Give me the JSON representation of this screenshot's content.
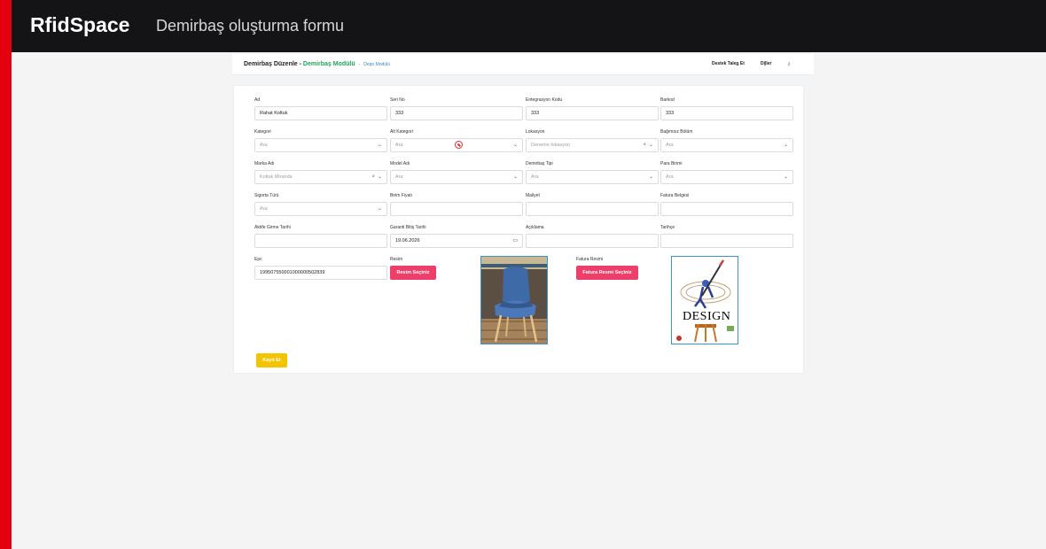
{
  "page": {
    "brand": "RfidSpace",
    "subtitle": "Demirbaş oluşturma formu"
  },
  "app": {
    "breadcrumb": {
      "title": "Demirbaş Düzenle -",
      "module": "Demirbaş Modülü",
      "separator": "-",
      "sub": "Depo Modülü"
    },
    "header_links": {
      "support": "Destek Talep Et",
      "languages": "Diller"
    }
  },
  "form": {
    "ad": {
      "label": "Ad",
      "value": "Rahat Koltuk"
    },
    "seri_no": {
      "label": "Seri No",
      "value": "333"
    },
    "entegrasyon_kodu": {
      "label": "Entegrasyon Kodu",
      "value": "333"
    },
    "barkod": {
      "label": "Barkod",
      "value": "333"
    },
    "kategori": {
      "label": "Kategori",
      "placeholder": "Ara"
    },
    "alt_kategori": {
      "label": "Alt Kategori",
      "placeholder": "Ara"
    },
    "lokasyon": {
      "label": "Lokasyon",
      "value": "Deneme lokasyon"
    },
    "bagimsiz_bolum": {
      "label": "Bağımsız Bölüm",
      "placeholder": "Ara"
    },
    "marka_adi": {
      "label": "Marka Adı",
      "value": "Koltuk Miranda"
    },
    "model_adi": {
      "label": "Model Adı",
      "placeholder": "Ara"
    },
    "demirbas_tipi": {
      "label": "Demirbaş Tipi",
      "placeholder": "Ara"
    },
    "para_birimi": {
      "label": "Para Birimi",
      "placeholder": "Ara"
    },
    "sigorta_turu": {
      "label": "Sigorta Türü",
      "placeholder": "Ara"
    },
    "birim_fiyati": {
      "label": "Birim Fiyatı",
      "value": ""
    },
    "maliyet": {
      "label": "Maliyet",
      "value": ""
    },
    "fatura_belgesi": {
      "label": "Fatura Belgesi",
      "value": ""
    },
    "aktife_girme_tarihi": {
      "label": "Aktife Girme Tarihi",
      "value": ""
    },
    "garanti_bitis_tarihi": {
      "label": "Garanti Bitiş Tarihi",
      "value": "19.06.2026"
    },
    "aciklama": {
      "label": "Açıklama",
      "value": ""
    },
    "tarihce": {
      "label": "Tarihçe",
      "value": ""
    },
    "epc": {
      "label": "Epc",
      "value": "199507550001000000502839"
    },
    "resim": {
      "label": "Resim",
      "button": "Resim Seçiniz"
    },
    "fatura_resmi": {
      "label": "Fatura Resmi",
      "button": "Fatura Resmi Seçiniz"
    },
    "design_image_text": "DESIGN",
    "save_button": "Kayıt Et"
  },
  "icons": {
    "chevron": "chevron-down-icon",
    "clear": "close-icon",
    "forbidden": "forbidden-cursor-icon",
    "calendar": "calendar-icon",
    "download": "download-icon"
  },
  "colors": {
    "brand_red": "#e3000f",
    "topbar": "#141416",
    "primary_button": "#ee3f6a",
    "save_button": "#f5c400",
    "module_green": "#22a35a"
  }
}
